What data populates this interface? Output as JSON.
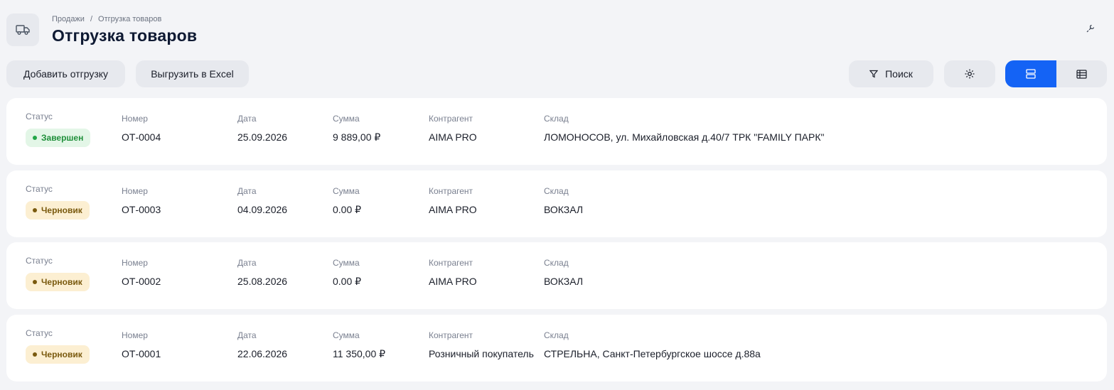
{
  "header": {
    "breadcrumb": [
      "Продажи",
      "Отгрузка товаров"
    ],
    "title": "Отгрузка товаров",
    "icon": "truck-icon"
  },
  "toolbar": {
    "add_label": "Добавить отгрузку",
    "export_label": "Выгрузить в Excel",
    "search_label": "Поиск"
  },
  "labels": {
    "status": "Статус",
    "number": "Номер",
    "date": "Дата",
    "sum": "Сумма",
    "counterparty": "Контрагент",
    "warehouse": "Склад"
  },
  "colors": {
    "accent": "#1463f5",
    "done": "#22a648",
    "draft": "#7a5a0e"
  },
  "rows": [
    {
      "status": "Завершен",
      "status_kind": "done",
      "number": "ОТ-0004",
      "date": "25.09.2026",
      "sum": "9 889,00 ₽",
      "counterparty": "AIMA PRO",
      "warehouse": "ЛОМОНОСОВ, ул. Михайловская д.40/7 ТРК \"FAMILY ПАРК\""
    },
    {
      "status": "Черновик",
      "status_kind": "draft",
      "number": "ОТ-0003",
      "date": "04.09.2026",
      "sum": "0.00 ₽",
      "counterparty": "AIMA PRO",
      "warehouse": "ВОКЗАЛ"
    },
    {
      "status": "Черновик",
      "status_kind": "draft",
      "number": "ОТ-0002",
      "date": "25.08.2026",
      "sum": "0.00 ₽",
      "counterparty": "AIMA PRO",
      "warehouse": "ВОКЗАЛ"
    },
    {
      "status": "Черновик",
      "status_kind": "draft",
      "number": "ОТ-0001",
      "date": "22.06.2026",
      "sum": "11 350,00 ₽",
      "counterparty": "Розничный покупатель",
      "warehouse": "СТРЕЛЬНА, Санкт-Петербургское шоссе д.88а"
    }
  ]
}
